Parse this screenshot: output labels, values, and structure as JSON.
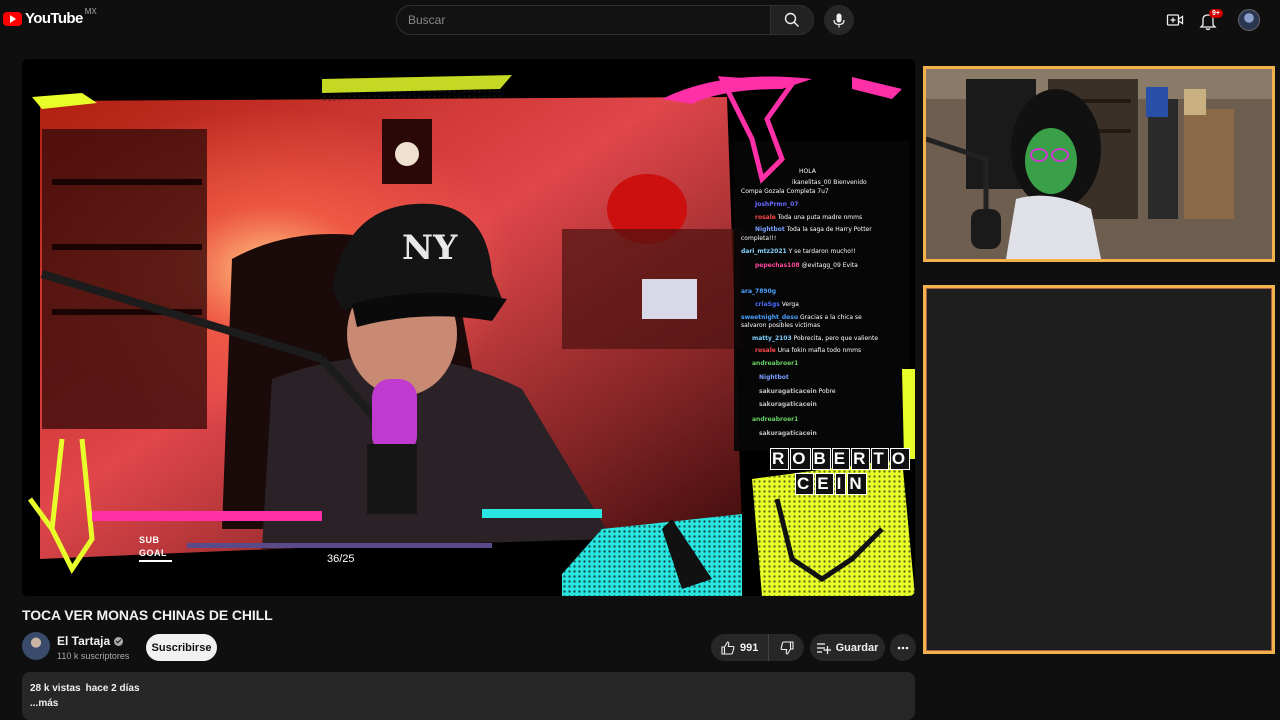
{
  "header": {
    "logo_text": "YouTube",
    "region": "MX",
    "search_placeholder": "Buscar",
    "notifications_badge": "9+"
  },
  "player": {
    "stream_goal": {
      "label_line1": "SUB",
      "label_line2": "GOAL",
      "progress_text": "36/25"
    },
    "name_tag": {
      "line1": [
        "R",
        "O",
        "B",
        "E",
        "R",
        "T",
        "O"
      ],
      "line2": [
        "C",
        "E",
        "I",
        "N"
      ]
    },
    "chat": [
      {
        "user": "",
        "text": "HOLA"
      },
      {
        "user": "",
        "text": "ikanelitas_00 Bienvenido"
      },
      {
        "user": "",
        "text": "Compa   Gozala Completa 7u7"
      },
      {
        "user": "JoshPrmn_07",
        "text": ""
      },
      {
        "user": "rosale",
        "text": "Toda una puta madre nmms"
      },
      {
        "user": "Nightbot",
        "text": "Toda la saga de Harry Potter"
      },
      {
        "user": "",
        "text": "completa!!!"
      },
      {
        "user": "dari_mtz2021",
        "text": "Y se tardaron mucho!!"
      },
      {
        "user": "pepechas108",
        "text": "@evitagg_09 Evita"
      },
      {
        "user": "ara_7890g",
        "text": ""
      },
      {
        "user": "criaSgs",
        "text": "Verga"
      },
      {
        "user": "sweetnight_desu",
        "text": "Gracias a la chica se"
      },
      {
        "user": "",
        "text": "salvaron posibles victimas"
      },
      {
        "user": "matty_2103",
        "text": "Pobrecita, pero que valiente"
      },
      {
        "user": "rosale",
        "text": "Una fokin mafia todo nmms"
      },
      {
        "user": "andreabroer1",
        "text": ""
      },
      {
        "user": "Nightbot",
        "text": ""
      },
      {
        "user": "sakuragaticacein",
        "text": "Pobre"
      },
      {
        "user": "sakuragaticacein",
        "text": ""
      },
      {
        "user": "andreabroer1",
        "text": ""
      },
      {
        "user": "sakuragaticacein",
        "text": ""
      }
    ]
  },
  "video": {
    "title": "TOCA VER MONAS CHINAS DE CHILL",
    "channel_name": "El Tartaja",
    "subscribers": "110 k suscriptores",
    "subscribe_label": "Suscribirse",
    "likes": "991",
    "save_label": "Guardar",
    "views": "28 k vistas",
    "date": "hace 2 días",
    "more_label": "...más"
  },
  "colors": {
    "accent": "#ff0000",
    "frame_border": "#f2b14a",
    "neon_pink": "#ff2fa8",
    "neon_yellow": "#e8ff2a",
    "neon_cyan": "#29e6e0"
  }
}
